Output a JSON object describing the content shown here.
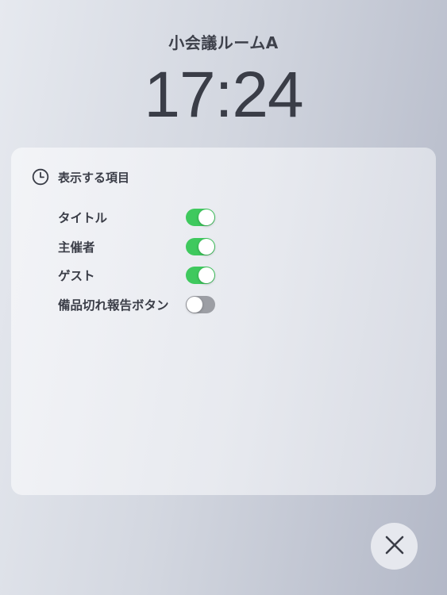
{
  "room": {
    "name": "小会議ルームA"
  },
  "clock": {
    "time": "17:24"
  },
  "panel": {
    "icon": "clock-icon",
    "title": "表示する項目",
    "options": [
      {
        "label": "タイトル",
        "enabled": true
      },
      {
        "label": "主催者",
        "enabled": true
      },
      {
        "label": "ゲスト",
        "enabled": true
      },
      {
        "label": "備品切れ報告ボタン",
        "enabled": false
      }
    ]
  },
  "close_button": {
    "icon": "close-icon"
  },
  "colors": {
    "toggle_on": "#3fc95e",
    "toggle_off": "#9c9ea4",
    "text": "#3a3d47"
  }
}
